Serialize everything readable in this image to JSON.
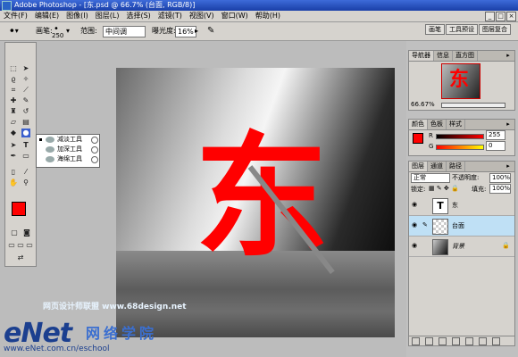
{
  "titlebar": {
    "title": "Adobe Photoshop - [东.psd @ 66.7% (台面, RGB/8)]"
  },
  "menu": [
    "文件(F)",
    "编辑(E)",
    "图像(I)",
    "图层(L)",
    "选择(S)",
    "滤镜(T)",
    "视图(V)",
    "窗口(W)",
    "帮助(H)"
  ],
  "options": {
    "brush_label": "画笔:",
    "brush_size": "250",
    "range_label": "范围:",
    "range_value": "中间调",
    "exposure_label": "曝光度:",
    "exposure_value": "16%"
  },
  "palette_tabs": [
    "画笔",
    "工具预设",
    "图层复合"
  ],
  "tool_popup": {
    "items": [
      "减淡工具",
      "加深工具",
      "海绵工具"
    ],
    "selected_index": 0
  },
  "foreground_color": "#ff0000",
  "canvas": {
    "glyph": "东"
  },
  "navigator": {
    "tabs": [
      "导航器",
      "信息",
      "直方图"
    ],
    "zoom": "66.67%",
    "thumb_glyph": "东"
  },
  "color_panel": {
    "tabs": [
      "颜色",
      "色板",
      "样式"
    ],
    "r_label": "R",
    "r_value": "255",
    "g_label": "G",
    "g_value": "0"
  },
  "layers_panel": {
    "tabs": [
      "图层",
      "通道",
      "路径"
    ],
    "blend_mode": "正常",
    "opacity_label": "不透明度:",
    "opacity": "100%",
    "lock_label": "锁定:",
    "fill_label": "填充:",
    "fill": "100%",
    "layers": [
      {
        "name": "东",
        "type": "text"
      },
      {
        "name": "台面",
        "type": "pixel",
        "selected": true
      },
      {
        "name": "背景",
        "type": "background",
        "locked": true
      }
    ]
  },
  "watermarks": {
    "line1": "网页设计师联盟 www.68design.net",
    "enet": "eNet",
    "enet_cn": "网络学院",
    "enet_url": "www.eNet.com.cn/eschool"
  }
}
